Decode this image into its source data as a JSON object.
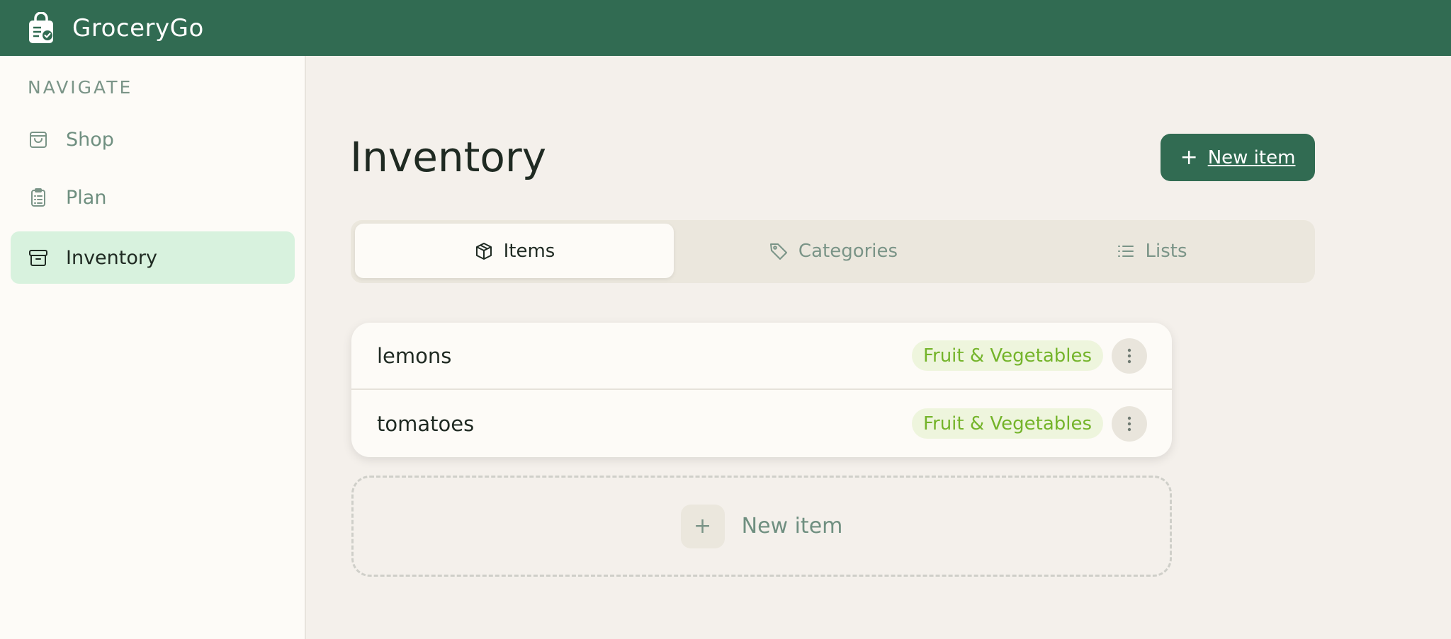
{
  "app": {
    "title": "GroceryGo"
  },
  "sidebar": {
    "section_label": "NAVIGATE",
    "items": [
      {
        "label": "Shop",
        "icon": "shopping-bag-icon",
        "active": false
      },
      {
        "label": "Plan",
        "icon": "clipboard-list-icon",
        "active": false
      },
      {
        "label": "Inventory",
        "icon": "archive-box-icon",
        "active": true
      }
    ]
  },
  "main": {
    "title": "Inventory",
    "new_item_button": {
      "plus": "+",
      "label": "New item"
    },
    "tabs": [
      {
        "label": "Items",
        "icon": "cube-icon",
        "active": true
      },
      {
        "label": "Categories",
        "icon": "tag-icon",
        "active": false
      },
      {
        "label": "Lists",
        "icon": "list-icon",
        "active": false
      }
    ],
    "items": [
      {
        "name": "lemons",
        "category": "Fruit & Vegetables"
      },
      {
        "name": "tomatoes",
        "category": "Fruit & Vegetables"
      }
    ],
    "add_card": {
      "plus": "+",
      "label": "New item"
    }
  },
  "colors": {
    "brand": "#316b52",
    "active_nav_bg": "#d8f2de",
    "badge_text": "#74b42a",
    "badge_bg": "#eef5dd"
  }
}
